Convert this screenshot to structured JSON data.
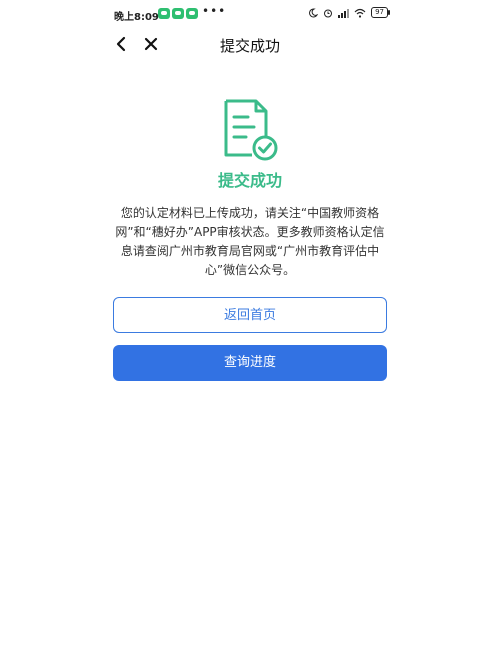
{
  "status_bar": {
    "time": "晚上8:09",
    "battery": "97",
    "icons": [
      "wechat-icon",
      "wechat-icon",
      "wechat-icon",
      "moon-icon",
      "alarm-icon",
      "signal-icon",
      "wifi-icon",
      "battery-icon"
    ]
  },
  "nav": {
    "title": "提交成功"
  },
  "content": {
    "success_title": "提交成功",
    "message": "您的认定材料已上传成功，请关注“中国教师资格网”和“穗好办”APP审核状态。更多教师资格认定信息请查阅广州市教育局官网或“广州市教育评估中心”微信公众号。",
    "accent_color": "#3bbb8a"
  },
  "buttons": {
    "home_label": "返回首页",
    "progress_label": "查询进度",
    "primary_color": "#3272e3"
  }
}
